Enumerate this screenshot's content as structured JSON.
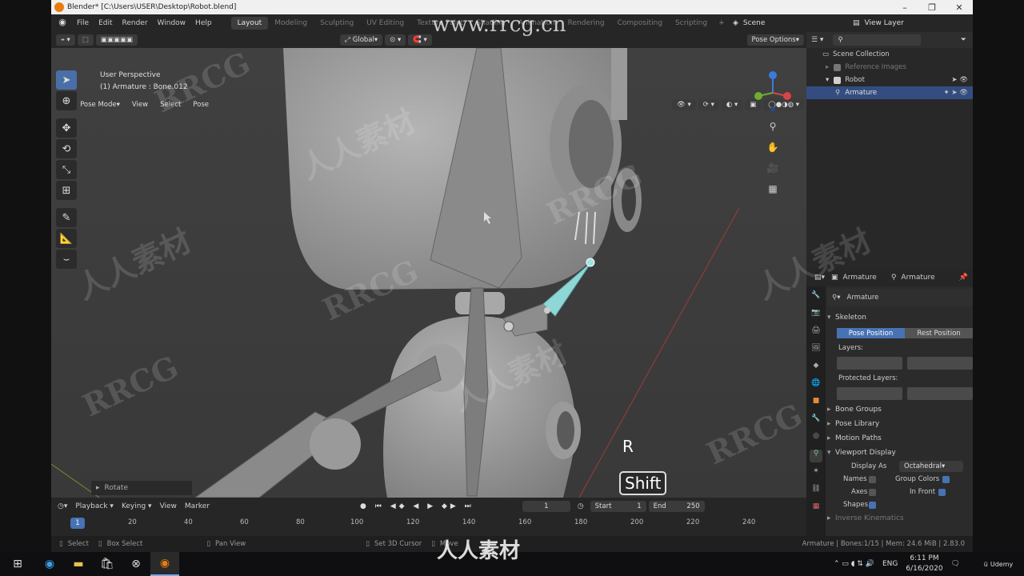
{
  "window": {
    "title": "Blender* [C:\\Users\\USER\\Desktop\\Robot.blend]"
  },
  "menu": {
    "items": [
      "File",
      "Edit",
      "Render",
      "Window",
      "Help"
    ],
    "workspaces": [
      "Layout",
      "Modeling",
      "Sculpting",
      "UV Editing",
      "Texture Paint",
      "Shading",
      "Animation",
      "Rendering",
      "Compositing",
      "Scripting"
    ],
    "active_workspace": "Layout",
    "scene_label": "Scene",
    "view_layer_label": "View Layer"
  },
  "viewport_header": {
    "mode": "Pose Mode",
    "menus": [
      "View",
      "Select",
      "Pose"
    ],
    "orientation": "Global",
    "pose_options": "Pose Options"
  },
  "viewport": {
    "perspective": "User Perspective",
    "selection": "(1) Armature : Bone.012",
    "last_op": "Rotate",
    "key_r": "R",
    "key_shift": "Shift"
  },
  "outliner": {
    "root": "Scene Collection",
    "rows": [
      {
        "label": "Reference Images"
      },
      {
        "label": "Robot"
      },
      {
        "label": "Armature"
      }
    ]
  },
  "properties": {
    "header_left": "Armature",
    "header_right": "Armature",
    "datablock": "Armature",
    "skeleton": "Skeleton",
    "pose_position": "Pose Position",
    "rest_position": "Rest Position",
    "layers": "Layers:",
    "protected_layers": "Protected Layers:",
    "bone_groups": "Bone Groups",
    "pose_library": "Pose Library",
    "motion_paths": "Motion Paths",
    "viewport_display": "Viewport Display",
    "display_as_label": "Display As",
    "display_as_value": "Octahedral",
    "names": "Names",
    "group_colors": "Group Colors",
    "axes": "Axes",
    "in_front": "In Front",
    "shapes": "Shapes",
    "inverse_kinematics": "Inverse Kinematics"
  },
  "timeline": {
    "menus": [
      "Playback",
      "Keying",
      "View",
      "Marker"
    ],
    "current_frame": "1",
    "start_label": "Start",
    "start_value": "1",
    "end_label": "End",
    "end_value": "250",
    "ticks": [
      "20",
      "40",
      "60",
      "80",
      "100",
      "120",
      "140",
      "160",
      "180",
      "200",
      "220",
      "240"
    ],
    "frame_indicator": "1"
  },
  "statusbar": {
    "select": "Select",
    "box_select": "Box Select",
    "pan_view": "Pan View",
    "cursor": "Set 3D Cursor",
    "move": "Move",
    "info": "Armature | Bones:1/15 | Mem: 24.6 MiB | 2.83.0"
  },
  "taskbar": {
    "lang": "ENG",
    "time": "6:11 PM",
    "date": "6/16/2020",
    "udemy": "Udemy"
  },
  "watermarks": {
    "site": "www.rrcg.cn",
    "brand": "人人素材",
    "logo": "RRCG"
  },
  "colors": {
    "accent": "#4772b3",
    "blender_orange": "#e87d0d",
    "bone_selected": "#8fd6d6"
  }
}
